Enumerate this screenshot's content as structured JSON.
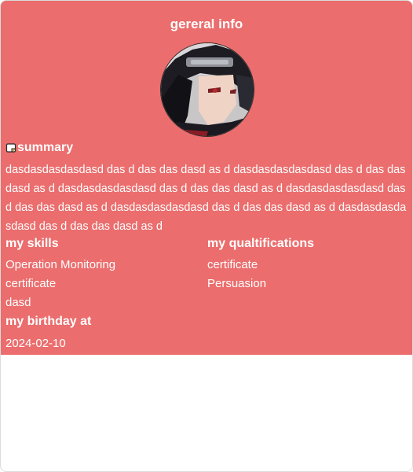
{
  "card": {
    "title": "gereral info",
    "accent_color": "#eb6d6d"
  },
  "avatar": {
    "icon": "anime-character-avatar"
  },
  "summary": {
    "label": "summary",
    "icon": "note-icon",
    "text": "dasdasdasdasdasd das d das das dasd as d dasdasdasdasdasd das d das das dasd as d dasdasdasdasdasd das d das das dasd as d dasdasdasdasdasd das d das das dasd as d dasdasdasdasdasd das d das das dasd as d dasdasdasdasdasd das d das das dasd as d"
  },
  "skills": {
    "label": "my skills",
    "items": [
      "Operation Monitoring",
      "certificate",
      "dasd"
    ]
  },
  "qualifications": {
    "label": "my qualtifications",
    "items": [
      "certificate",
      "Persuasion"
    ]
  },
  "birthday": {
    "label": "my birthday at",
    "value": "2024-02-10"
  }
}
